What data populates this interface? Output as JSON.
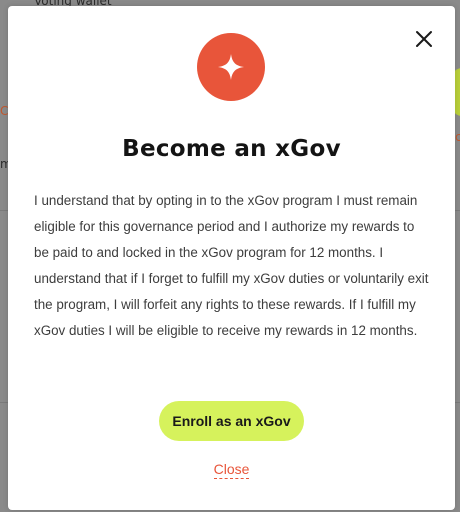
{
  "background": {
    "wallet_label": "Voting wallet",
    "edge_left_accent": "C",
    "edge_left_text": "m",
    "edge_right_accent": "c"
  },
  "modal": {
    "title": "Become an xGov",
    "body": "I understand that by opting in to the xGov program I must remain eligible for this governance period and I authorize my rewards to be paid to and locked in the xGov program for 12 months. I understand that if I forget to fulfill my xGov duties or voluntarily exit the program, I will forfeit any rights to these rewards. If I fulfill my xGov duties I will be eligible to receive my rewards in 12 months.",
    "enroll_label": "Enroll as an xGov",
    "close_label": "Close",
    "badge_icon": "sparkle-icon",
    "close_icon": "close-icon"
  },
  "colors": {
    "accent": "#e8553a",
    "button_bg": "#d6f25c",
    "title": "#141414",
    "body": "#3d3d3d",
    "overlay": "#8a8a8a"
  }
}
